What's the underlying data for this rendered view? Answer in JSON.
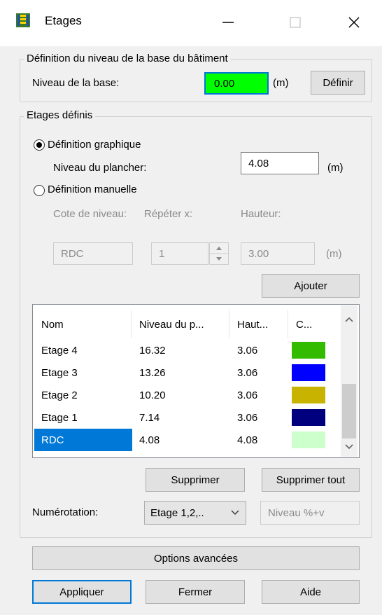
{
  "window": {
    "title": "Etages",
    "icon": "building-floors-icon"
  },
  "base_group": {
    "legend": "Définition du niveau de la base du bâtiment",
    "label": "Niveau de la base:",
    "value": "0.00",
    "value_bg": "#00ff00",
    "unit": "(m)",
    "define_button": "Définir"
  },
  "floors_group": {
    "legend": "Etages définis",
    "graphic": {
      "label": "Définition graphique",
      "selected": true,
      "floor_label": "Niveau du plancher:",
      "floor_value": "4.08",
      "unit": "(m)"
    },
    "manual": {
      "label": "Définition manuelle",
      "selected": false,
      "col_level": "Cote de niveau:",
      "col_repeat": "Répéter x:",
      "col_height": "Hauteur:",
      "level_value": "RDC",
      "repeat_value": "1",
      "height_value": "3.00",
      "unit": "(m)",
      "add_button": "Ajouter"
    },
    "table": {
      "headers": [
        "Nom",
        "Niveau du p...",
        "Haut...",
        "C..."
      ],
      "rows": [
        {
          "name": "Etage 4",
          "level": "16.32",
          "height": "3.06",
          "color": "#33bb00"
        },
        {
          "name": "Etage 3",
          "level": "13.26",
          "height": "3.06",
          "color": "#0000ff"
        },
        {
          "name": "Etage 2",
          "level": "10.20",
          "height": "3.06",
          "color": "#c8b400"
        },
        {
          "name": "Etage 1",
          "level": "7.14",
          "height": "3.06",
          "color": "#00007f"
        },
        {
          "name": "RDC",
          "level": "4.08",
          "height": "4.08",
          "color": "#ccffcc",
          "selected": true
        }
      ],
      "selection_color": "#0078d7"
    },
    "delete_button": "Supprimer",
    "delete_all_button": "Supprimer tout",
    "numbering_label": "Numérotation:",
    "numbering_value": "Etage 1,2,..",
    "numbering_pattern": "Niveau %+v"
  },
  "advanced_button": "Options avancées",
  "footer": {
    "apply": "Appliquer",
    "close": "Fermer",
    "help": "Aide"
  }
}
